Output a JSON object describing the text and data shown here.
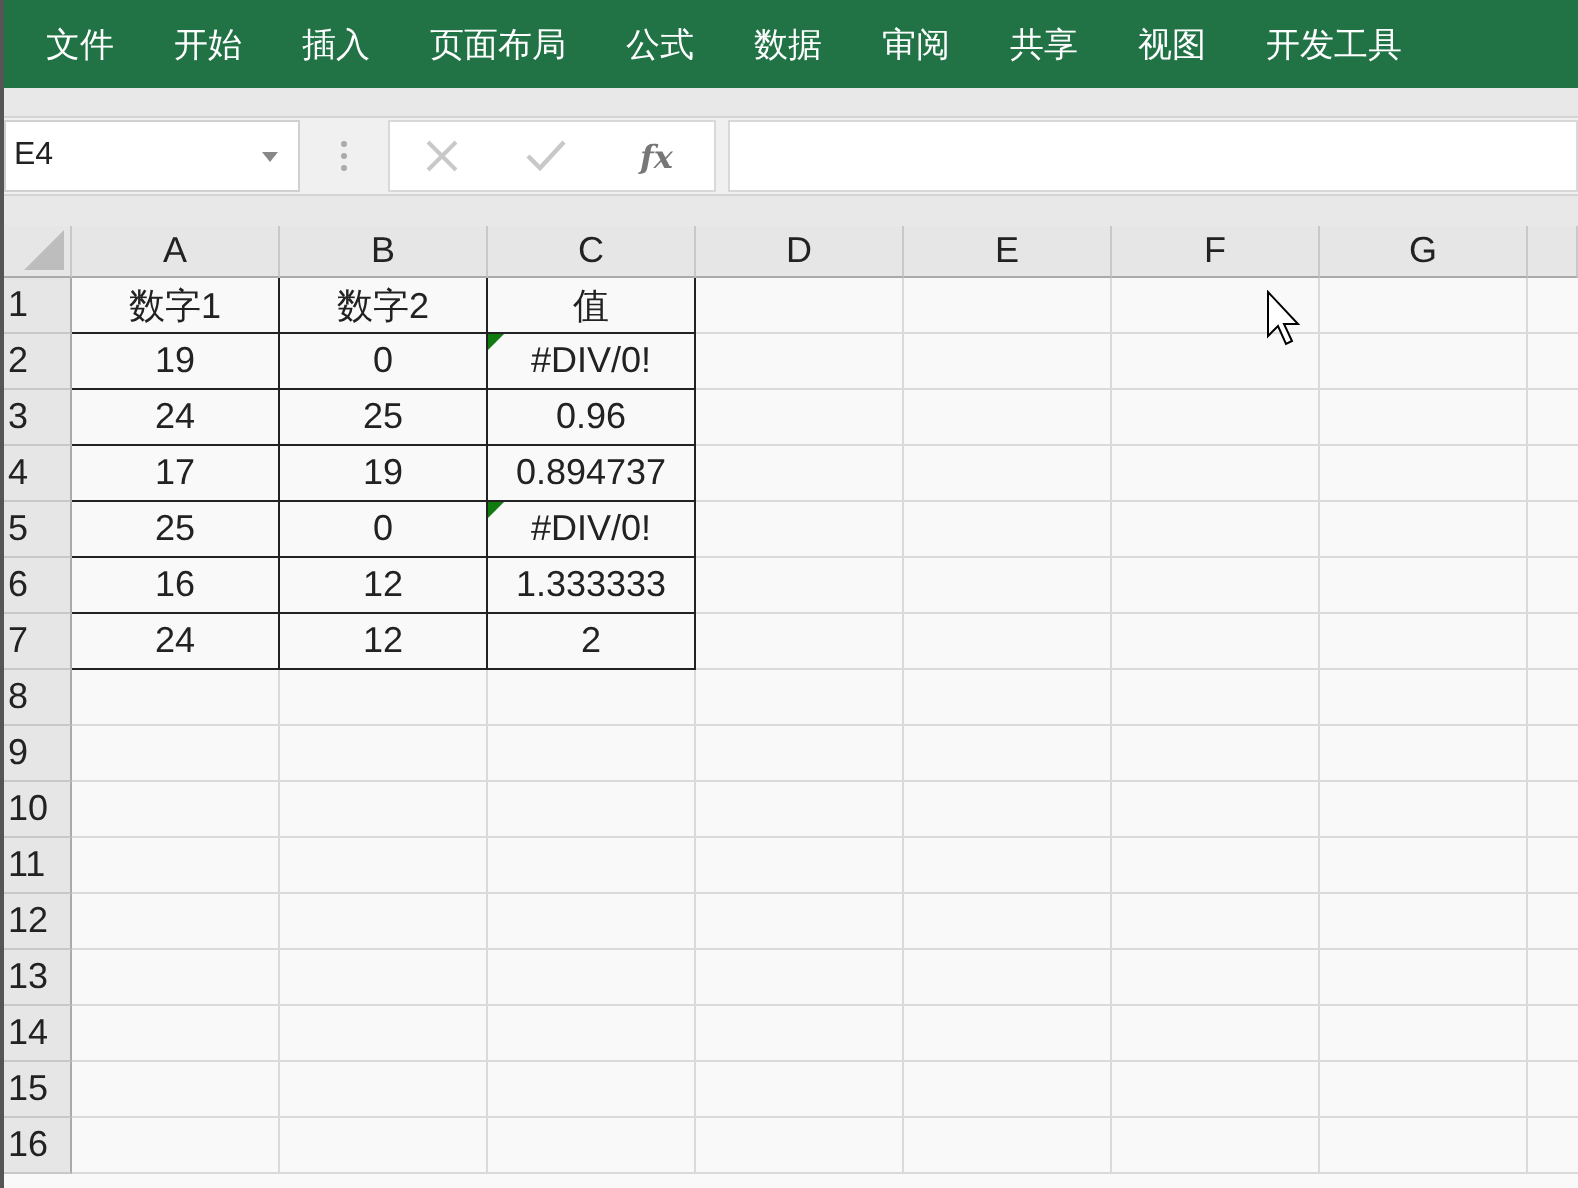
{
  "ribbon": {
    "tabs": [
      {
        "label": "文件"
      },
      {
        "label": "开始"
      },
      {
        "label": "插入"
      },
      {
        "label": "页面布局"
      },
      {
        "label": "公式"
      },
      {
        "label": "数据"
      },
      {
        "label": "审阅"
      },
      {
        "label": "共享"
      },
      {
        "label": "视图"
      },
      {
        "label": "开发工具"
      }
    ]
  },
  "name_box": {
    "value": "E4"
  },
  "formula_bar": {
    "fx": "fx"
  },
  "sheet": {
    "columns": [
      "A",
      "B",
      "C",
      "D",
      "E",
      "F",
      "G"
    ],
    "rows": [
      {
        "number": "1",
        "cells": [
          {
            "value": "数字1",
            "error_flag": false
          },
          {
            "value": "数字2",
            "error_flag": false
          },
          {
            "value": "值",
            "error_flag": false
          }
        ]
      },
      {
        "number": "2",
        "cells": [
          {
            "value": "19",
            "error_flag": false
          },
          {
            "value": "0",
            "error_flag": false
          },
          {
            "value": "#DIV/0!",
            "error_flag": true
          }
        ]
      },
      {
        "number": "3",
        "cells": [
          {
            "value": "24",
            "error_flag": false
          },
          {
            "value": "25",
            "error_flag": false
          },
          {
            "value": "0.96",
            "error_flag": false
          }
        ]
      },
      {
        "number": "4",
        "cells": [
          {
            "value": "17",
            "error_flag": false
          },
          {
            "value": "19",
            "error_flag": false
          },
          {
            "value": "0.894737",
            "error_flag": false
          }
        ]
      },
      {
        "number": "5",
        "cells": [
          {
            "value": "25",
            "error_flag": false
          },
          {
            "value": "0",
            "error_flag": false
          },
          {
            "value": "#DIV/0!",
            "error_flag": true
          }
        ]
      },
      {
        "number": "6",
        "cells": [
          {
            "value": "16",
            "error_flag": false
          },
          {
            "value": "12",
            "error_flag": false
          },
          {
            "value": "1.333333",
            "error_flag": false
          }
        ]
      },
      {
        "number": "7",
        "cells": [
          {
            "value": "24",
            "error_flag": false
          },
          {
            "value": "12",
            "error_flag": false
          },
          {
            "value": "2",
            "error_flag": false
          }
        ]
      },
      {
        "number": "8",
        "cells": []
      },
      {
        "number": "9",
        "cells": []
      },
      {
        "number": "10",
        "cells": []
      },
      {
        "number": "11",
        "cells": []
      },
      {
        "number": "12",
        "cells": []
      },
      {
        "number": "13",
        "cells": []
      },
      {
        "number": "14",
        "cells": []
      },
      {
        "number": "15",
        "cells": []
      },
      {
        "number": "16",
        "cells": []
      }
    ]
  }
}
